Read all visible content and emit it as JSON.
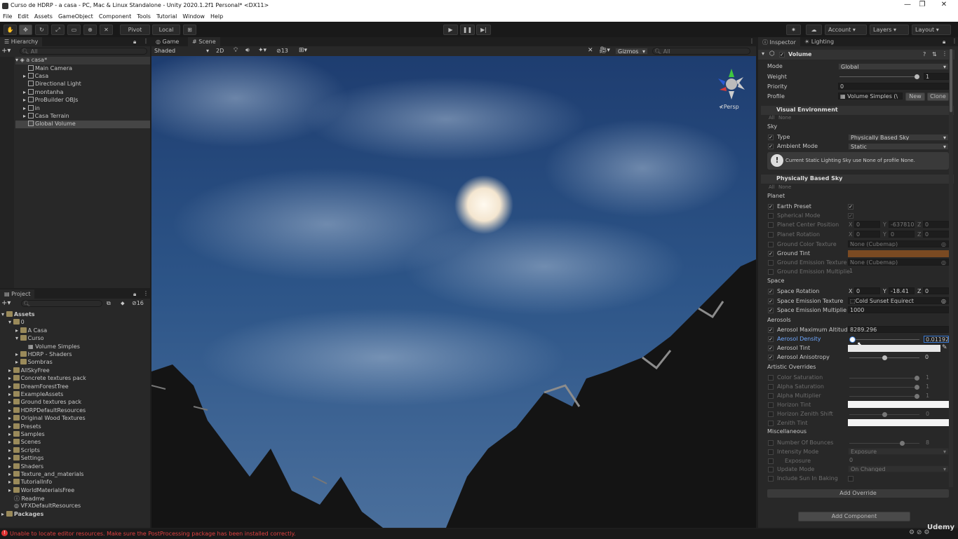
{
  "window": {
    "title": "Curso de HDRP - a casa - PC, Mac & Linux Standalone - Unity 2020.1.2f1 Personal* <DX11>",
    "min": "—",
    "max": "❐",
    "close": "✕"
  },
  "menu": [
    "File",
    "Edit",
    "Assets",
    "GameObject",
    "Component",
    "Tools",
    "Tutorial",
    "Window",
    "Help"
  ],
  "toolbar": {
    "pivot": "Pivot",
    "local": "Local",
    "account": "Account",
    "layers": "Layers",
    "layout": "Layout"
  },
  "hierarchy": {
    "tab": "Hierarchy",
    "search_placeholder": "All",
    "scene": "a casa*",
    "items": [
      "Main Camera",
      "Casa",
      "Directional Light",
      "montanha",
      "ProBuilder OBJs",
      "in",
      "Casa Terrain",
      "Global Volume"
    ]
  },
  "project": {
    "tab": "Project",
    "count": "16",
    "items": [
      "Assets",
      "0",
      "A Casa",
      "Curso",
      "Volume Simples",
      "HDRP - Shaders",
      "Sombras",
      "AllSkyFree",
      "Concrete textures pack",
      "DreamForestTree",
      "ExampleAssets",
      "Ground textures pack",
      "HDRPDefaultResources",
      "Original Wood Textures",
      "Presets",
      "Samples",
      "Scenes",
      "Scripts",
      "Settings",
      "Shaders",
      "Texture_and_materials",
      "TutorialInfo",
      "WorldMaterialsFree",
      "Readme",
      "VFXDefaultResources",
      "Packages"
    ]
  },
  "scene": {
    "tab_game": "Game",
    "tab_scene": "Scene",
    "shading": "Shaded",
    "mode2d": "2D",
    "count": "13",
    "gizmos": "Gizmos",
    "search_placeholder": "All",
    "persp": "Persp"
  },
  "inspector": {
    "tab": "Inspector",
    "tab2": "Lighting",
    "component": "Volume",
    "mode_label": "Mode",
    "mode": "Global",
    "weight_label": "Weight",
    "weight": "1",
    "priority_label": "Priority",
    "priority": "0",
    "profile_label": "Profile",
    "profile": "Volume Simples (\\",
    "new": "New",
    "clone": "Clone",
    "visual_env": "Visual Environment",
    "all": "All",
    "none": "None",
    "sky": "Sky",
    "type_label": "Type",
    "type": "Physically Based Sky",
    "ambient_label": "Ambient Mode",
    "ambient": "Static",
    "info": "Current Static Lighting Sky use None of profile None.",
    "pbs": "Physically Based Sky",
    "planet": "Planet",
    "earth_preset": "Earth Preset",
    "spherical": "Spherical Mode",
    "planet_center": "Planet Center Position",
    "pc_x": "0",
    "pc_y": "-637810",
    "pc_z": "0",
    "planet_rot": "Planet Rotation",
    "pr_x": "0",
    "pr_y": "0",
    "pr_z": "0",
    "ground_color_tex": "Ground Color Texture",
    "none_cubemap": "None (Cubemap)",
    "ground_tint": "Ground Tint",
    "ground_emission_tex": "Ground Emission Texture",
    "ground_emission_mul": "Ground Emission Multiplie",
    "gem_val": "1",
    "space": "Space",
    "space_rot": "Space Rotation",
    "sr_x": "0",
    "sr_y": "-18.41",
    "sr_z": "0",
    "space_em_tex": "Space Emission Texture",
    "space_em_tex_val": "Cold Sunset Equirect",
    "space_em_mul": "Space Emission Multiplie",
    "space_em_mul_val": "1000",
    "aerosols": "Aerosols",
    "aer_alt": "Aerosol Maximum Altitud",
    "aer_alt_val": "8289.296",
    "aer_density": "Aerosol Density",
    "aer_density_val": "0.01192",
    "aer_tint": "Aerosol Tint",
    "aer_aniso": "Aerosol Anisotropy",
    "aer_aniso_val": "0",
    "artistic": "Artistic Overrides",
    "color_sat": "Color Saturation",
    "color_sat_val": "1",
    "alpha_sat": "Alpha Saturation",
    "alpha_sat_val": "1",
    "alpha_mul": "Alpha Multiplier",
    "alpha_mul_val": "1",
    "horizon_tint": "Horizon Tint",
    "hz_shift": "Horizon Zenith Shift",
    "hz_shift_val": "0",
    "zenith_tint": "Zenith Tint",
    "misc": "Miscellaneous",
    "bounces": "Number Of Bounces",
    "bounces_val": "8",
    "intensity_mode": "Intensity Mode",
    "intensity_mode_val": "Exposure",
    "exposure": "Exposure",
    "exposure_val": "0",
    "update_mode": "Update Mode",
    "update_mode_val": "On Changed",
    "sun_baking": "Include Sun In Baking",
    "add_override": "Add Override",
    "add_component": "Add Component"
  },
  "status": {
    "error": "Unable to locate editor resources. Make sure the PostProcessing package has been installed correctly.",
    "watermark": "Udemy"
  },
  "colors": {
    "ground_tint": "#7a4a22",
    "error": "#e04040"
  },
  "values": {
    "weight": 1,
    "aer_density": 0.01,
    "aer_aniso": 0.5,
    "hz_shift": 0.5,
    "bounces": 0.77
  }
}
